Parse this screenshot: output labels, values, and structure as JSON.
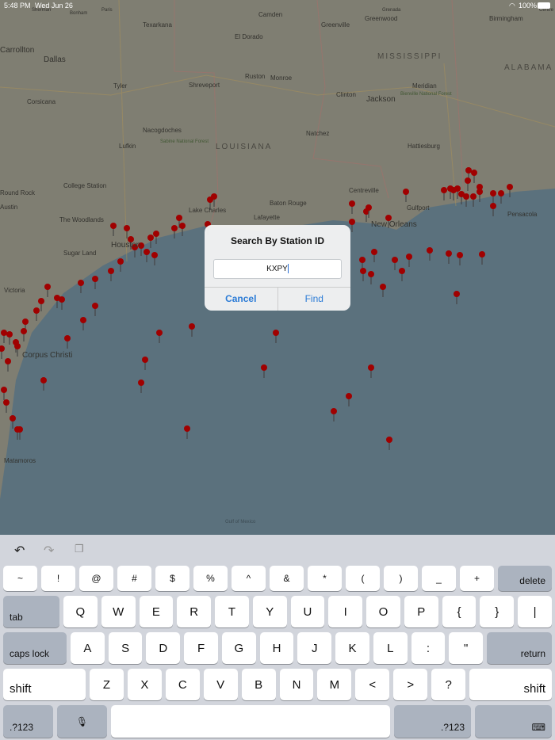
{
  "status": {
    "time": "5:48 PM",
    "date": "Wed Jun 26",
    "battery": "100%"
  },
  "map": {
    "labels": [
      "Texarkana",
      "Camden",
      "Greenwood",
      "Greenville",
      "El Dorado",
      "Dallas",
      "Carrollton",
      "Tyler",
      "Shreveport",
      "Ruston",
      "Monroe",
      "Clinton",
      "Jackson",
      "Meridian",
      "Corsicana",
      "Nacogdoches",
      "Natchez",
      "Lufkin",
      "Hattiesburg",
      "Sabine National Forest",
      "College Station",
      "Round Rock",
      "Austin",
      "The Woodlands",
      "Houston",
      "Sugar Land",
      "Lake Charles",
      "Baton Rouge",
      "Lafayette",
      "Gulfport",
      "Pensacola",
      "Centreville",
      "New Orleans",
      "Victoria",
      "Corpus Christi",
      "Matamoros",
      "Birmingham",
      "Bienville National Forest",
      "Gulf of Mexico",
      "Sherman",
      "Bonham",
      "Paris",
      "Grenada",
      "Centre"
    ],
    "states": [
      "MISSISSIPPI",
      "ALABAMA",
      "LOUISIANA"
    ]
  },
  "dialog": {
    "title": "Search By Station ID",
    "input_value": "KXPY",
    "cancel": "Cancel",
    "find": "Find"
  },
  "keyboard": {
    "row1": [
      "~",
      "!",
      "@",
      "#",
      "$",
      "%",
      "^",
      "&",
      "*",
      "(",
      ")",
      "_",
      "+"
    ],
    "delete": "delete",
    "tab": "tab",
    "row2": [
      "Q",
      "W",
      "E",
      "R",
      "T",
      "Y",
      "U",
      "I",
      "O",
      "P",
      "{",
      "}",
      "|"
    ],
    "caps": "caps lock",
    "row3": [
      "A",
      "S",
      "D",
      "F",
      "G",
      "H",
      "J",
      "K",
      "L",
      ":",
      "\""
    ],
    "return": "return",
    "shift": "shift",
    "row4": [
      "Z",
      "X",
      "C",
      "V",
      "B",
      "N",
      "M",
      "<",
      ">",
      "?"
    ],
    "numbers": ".?123"
  },
  "colors": {
    "water": "#6f8a99",
    "land": "#a6a495",
    "pin": "#c40000",
    "link": "#2b7bd6"
  }
}
